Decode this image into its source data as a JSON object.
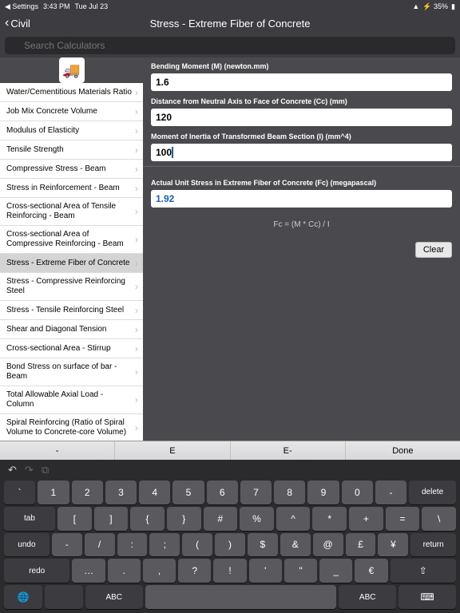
{
  "status": {
    "back_app": "Settings",
    "time": "3:43 PM",
    "date": "Tue Jul 23",
    "battery": "35%"
  },
  "nav": {
    "back": "Civil",
    "title": "Stress - Extreme Fiber of Concrete"
  },
  "search": {
    "placeholder": "Search Calculators"
  },
  "sidebar": {
    "items": [
      "Water/Cementitious Materials Ratio",
      "Job Mix Concrete Volume",
      "Modulus of Elasticity",
      "Tensile Strength",
      "Compressive Stress - Beam",
      "Stress in Reinforcement - Beam",
      "Cross-sectional Area of Tensile Reinforcing - Beam",
      "Cross-sectional Area of Compressive Reinforcing - Beam",
      "Stress - Extreme Fiber of Concrete",
      "Stress - Compressive Reinforcing Steel",
      "Stress - Tensile Reinforcing Steel",
      "Shear and Diagonal Tension",
      "Cross-sectional Area - Stirrup",
      "Bond Stress on surface of bar - Beam",
      "Total Allowable Axial Load - Column",
      "Spiral Reinforcing (Ratio of Spiral Volume to Concrete-core Volume)"
    ],
    "selected_index": 8
  },
  "fields": [
    {
      "label": "Bending Moment (M) (newton.mm)",
      "value": "1.6"
    },
    {
      "label": "Distance from Neutral Axis to Face of Concrete (Cc) (mm)",
      "value": "120"
    },
    {
      "label": "Moment of Inertia of Transformed Beam Section (I) (mm^4)",
      "value": "100"
    }
  ],
  "result": {
    "label": "Actual Unit Stress in Extreme Fiber of Concrete (Fc) (megapascal)",
    "value": "1.92"
  },
  "formula": "Fc = (M * Cc) / I",
  "clear_label": "Clear",
  "accessory": [
    "-",
    "E",
    "E-",
    "Done"
  ],
  "keyboard": {
    "row1": [
      "`",
      "1",
      "2",
      "3",
      "4",
      "5",
      "6",
      "7",
      "8",
      "9",
      "0",
      "-",
      "delete"
    ],
    "row2": [
      "tab",
      "[",
      "]",
      "{",
      "}",
      "#",
      "%",
      "^",
      "*",
      "+",
      "=",
      "\\"
    ],
    "row3": [
      "undo",
      "-",
      "/",
      ":",
      ";",
      "(",
      ")",
      "$",
      "&",
      "@",
      "£",
      "¥",
      "return"
    ],
    "row4": [
      "redo",
      "…",
      ".",
      ",",
      "?",
      "!",
      "'",
      "\"",
      "_",
      "€"
    ],
    "row5_abc": "ABC"
  }
}
